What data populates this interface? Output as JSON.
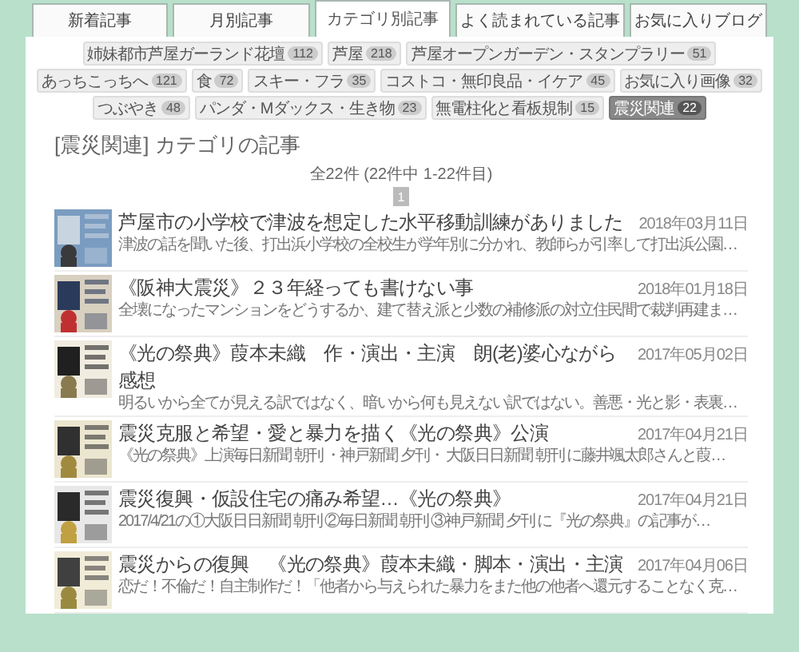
{
  "tabs": [
    {
      "label": "新着記事",
      "selected": false
    },
    {
      "label": "月別記事",
      "selected": false
    },
    {
      "label": "カテゴリ別記事",
      "selected": true
    },
    {
      "label": "よく読まれている記事",
      "selected": false
    },
    {
      "label": "お気に入りブログ",
      "selected": false
    }
  ],
  "category_tags": [
    {
      "label": "姉妹都市芦屋ガーランド花壇",
      "count": "112",
      "selected": false
    },
    {
      "label": "芦屋",
      "count": "218",
      "selected": false
    },
    {
      "label": "芦屋オープンガーデン・スタンプラリー",
      "count": "51",
      "selected": false
    },
    {
      "label": "あっちこっちへ",
      "count": "121",
      "selected": false
    },
    {
      "label": "食",
      "count": "72",
      "selected": false
    },
    {
      "label": "スキー・フラ",
      "count": "35",
      "selected": false
    },
    {
      "label": "コストコ・無印良品・イケア",
      "count": "45",
      "selected": false
    },
    {
      "label": "お気に入り画像",
      "count": "32",
      "selected": false
    },
    {
      "label": "つぶやき",
      "count": "48",
      "selected": false
    },
    {
      "label": "パンダ・Mダックス・生き物",
      "count": "23",
      "selected": false
    },
    {
      "label": "無電柱化と看板規制",
      "count": "15",
      "selected": false
    },
    {
      "label": "震災関連",
      "count": "22",
      "selected": true
    }
  ],
  "heading": "[震災関連] カテゴリの記事",
  "count_text": "全22件 (22件中 1-22件目)",
  "pages": [
    {
      "label": "1",
      "selected": true
    }
  ],
  "articles": [
    {
      "title": "芦屋市の小学校で津波を想定した水平移動訓練がありました",
      "date": "2018年03月11日",
      "excerpt": "津波の話を聞いた後、打出浜小学校の全校生が学年別に分かれ、教師らが引率して打出浜公園…"
    },
    {
      "title": "《阪神大震災》２３年経っても書けない事",
      "date": "2018年01月18日",
      "excerpt": "全壊になったマンションをどうするか、建て替え派と少数の補修派の対立住民間で裁判再建ま…"
    },
    {
      "title": "《光の祭典》葭本未織　作・演出・主演　朗(老)婆心ながら感想",
      "date": "2017年05月02日",
      "excerpt": "明るいから全てが見える訳ではなく、暗いから何も見えない訳ではない。善悪・光と影・表裏…"
    },
    {
      "title": "震災克服と希望・愛と暴力を描く《光の祭典》公演",
      "date": "2017年04月21日",
      "excerpt": "《光の祭典》上演毎日新聞 朝刊 ・神戸新聞 夕刊・ 大阪日日新聞 朝刊 に藤井颯太郎さんと葭…"
    },
    {
      "title": "震災復興・仮設住宅の痛み希望…《光の祭典》",
      "date": "2017年04月21日",
      "excerpt": "2017/4/21の①大阪日日新聞 朝刊 ②毎日新聞 朝刊 ③神戸新聞 夕刊 に『光の祭典』の記事が…"
    },
    {
      "title": "震災からの復興　《光の祭典》葭本未織・脚本・演出・主演",
      "date": "2017年04月06日",
      "excerpt": "恋だ！不倫だ！自主制作だ！「他者から与えられた暴力をまた他の他者へ還元することなく克…"
    }
  ]
}
